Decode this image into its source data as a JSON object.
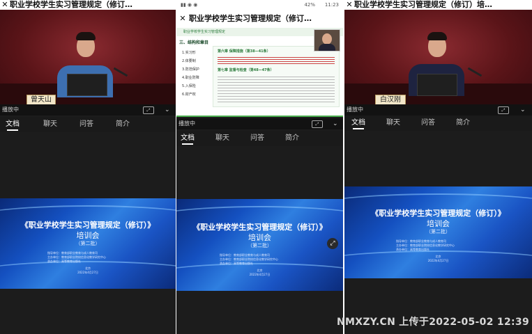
{
  "panels": [
    {
      "window_title": "职业学校学生实习管理规定（修订…",
      "nameplate": "曾天山",
      "status_left": "播放中",
      "tabs": [
        "文档",
        "聊天",
        "问答",
        "简介"
      ],
      "active_tab": "文档"
    },
    {
      "phone_status_left": "",
      "phone_status_right": "42%",
      "phone_time": "11:23",
      "window_title": "职业学校学生实习管理规定（修订…",
      "slide_header": "职业学校学生实习管理规定",
      "slide_section": "三、结构和章目",
      "slide_toc": [
        "1.实习形",
        "2.体要制",
        "3.防范保护",
        "4.职业防障",
        "5.入保险",
        "6.财产权"
      ],
      "slide_right": [
        "第六章 保障措施（第38—41条）",
        "第七章 监督与检查（第48—47条）"
      ],
      "status_left": "播放中",
      "tabs": [
        "文档",
        "聊天",
        "问答",
        "简介"
      ],
      "active_tab": "文档"
    },
    {
      "window_title": "职业学校学生实习管理规定（修订）培…",
      "nameplate": "白汉刚",
      "status_left": "播放中",
      "tabs": [
        "文档",
        "聊天",
        "问答",
        "简介"
      ],
      "active_tab": "文档"
    }
  ],
  "banner": {
    "title": "《职业学校学生实习管理规定（修订）》",
    "subtitle": "培训会",
    "batch": "（第二批）",
    "orgs": [
      "指导单位：教育部职业教育与成人教育司",
      "主办单位：教育部职业院校信息化教学研究中心",
      "承办单位：高等教育出版社"
    ],
    "footer_city": "北京",
    "footer_date": "2022年4月27日"
  },
  "watermark": "NMXZY.CN 上传于2022-05-02  12:39"
}
